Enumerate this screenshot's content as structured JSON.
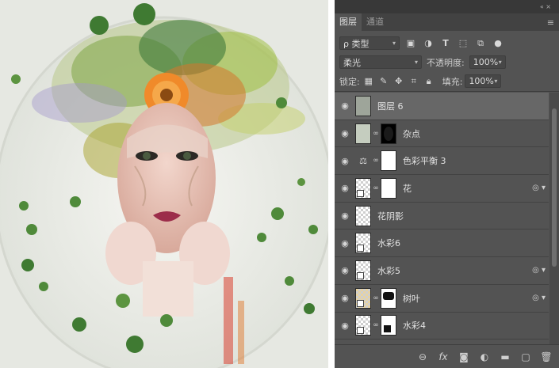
{
  "panel": {
    "window_controls": "« ×",
    "tabs": [
      {
        "label": "图层",
        "active": true
      },
      {
        "label": "通道",
        "active": false
      }
    ],
    "menu_icon": "hamburger-menu-icon",
    "filter": {
      "label": "ρ 类型",
      "icons": [
        "image-filter-icon",
        "adjustment-filter-icon",
        "type-filter-icon",
        "shape-filter-icon",
        "smart-object-filter-icon",
        "toggle-filter-icon"
      ]
    },
    "blend_mode": "柔光",
    "opacity": {
      "label": "不透明度:",
      "value": "100%"
    },
    "lock": {
      "label": "锁定:",
      "icons": [
        "lock-transparent-icon",
        "lock-paint-icon",
        "lock-position-icon",
        "lock-artboard-icon",
        "lock-all-icon"
      ]
    },
    "fill": {
      "label": "填充:",
      "value": "100%"
    },
    "layers": [
      {
        "name": "图层 6",
        "selected": true,
        "thumb": "portrait",
        "mask": false,
        "adjustment": false,
        "fx": false
      },
      {
        "name": "杂点",
        "selected": false,
        "thumb": "solid-gray",
        "mask": "black-oval",
        "adjustment": false,
        "fx": false
      },
      {
        "name": "色彩平衡 3",
        "selected": false,
        "thumb": "balance-icon",
        "mask": "white",
        "adjustment": true,
        "fx": false
      },
      {
        "name": "花",
        "selected": false,
        "thumb": "transparent",
        "mask": "white",
        "adjustment": false,
        "fx": true
      },
      {
        "name": "花阴影",
        "selected": false,
        "thumb": "transparent",
        "mask": false,
        "adjustment": false,
        "fx": false
      },
      {
        "name": "水彩6",
        "selected": false,
        "thumb": "transparent",
        "mask": false,
        "adjustment": false,
        "fx": false
      },
      {
        "name": "水彩5",
        "selected": false,
        "thumb": "transparent",
        "mask": false,
        "adjustment": false,
        "fx": true
      },
      {
        "name": "树叶",
        "selected": false,
        "thumb": "leaves",
        "mask": "black-shape",
        "adjustment": false,
        "fx": true
      },
      {
        "name": "水彩4",
        "selected": false,
        "thumb": "transparent",
        "mask": "white-shape",
        "adjustment": false,
        "fx": false
      }
    ],
    "bottom_icons": [
      "link-layers-icon",
      "fx-icon",
      "add-mask-icon",
      "adjustment-layer-icon",
      "new-group-icon",
      "new-layer-icon",
      "trash-icon"
    ],
    "bottom_labels": {
      "fx": "fx"
    }
  },
  "colors": {
    "panel_bg": "#535353",
    "selected_row": "#676767",
    "canvas_bg": "#eceeea"
  }
}
